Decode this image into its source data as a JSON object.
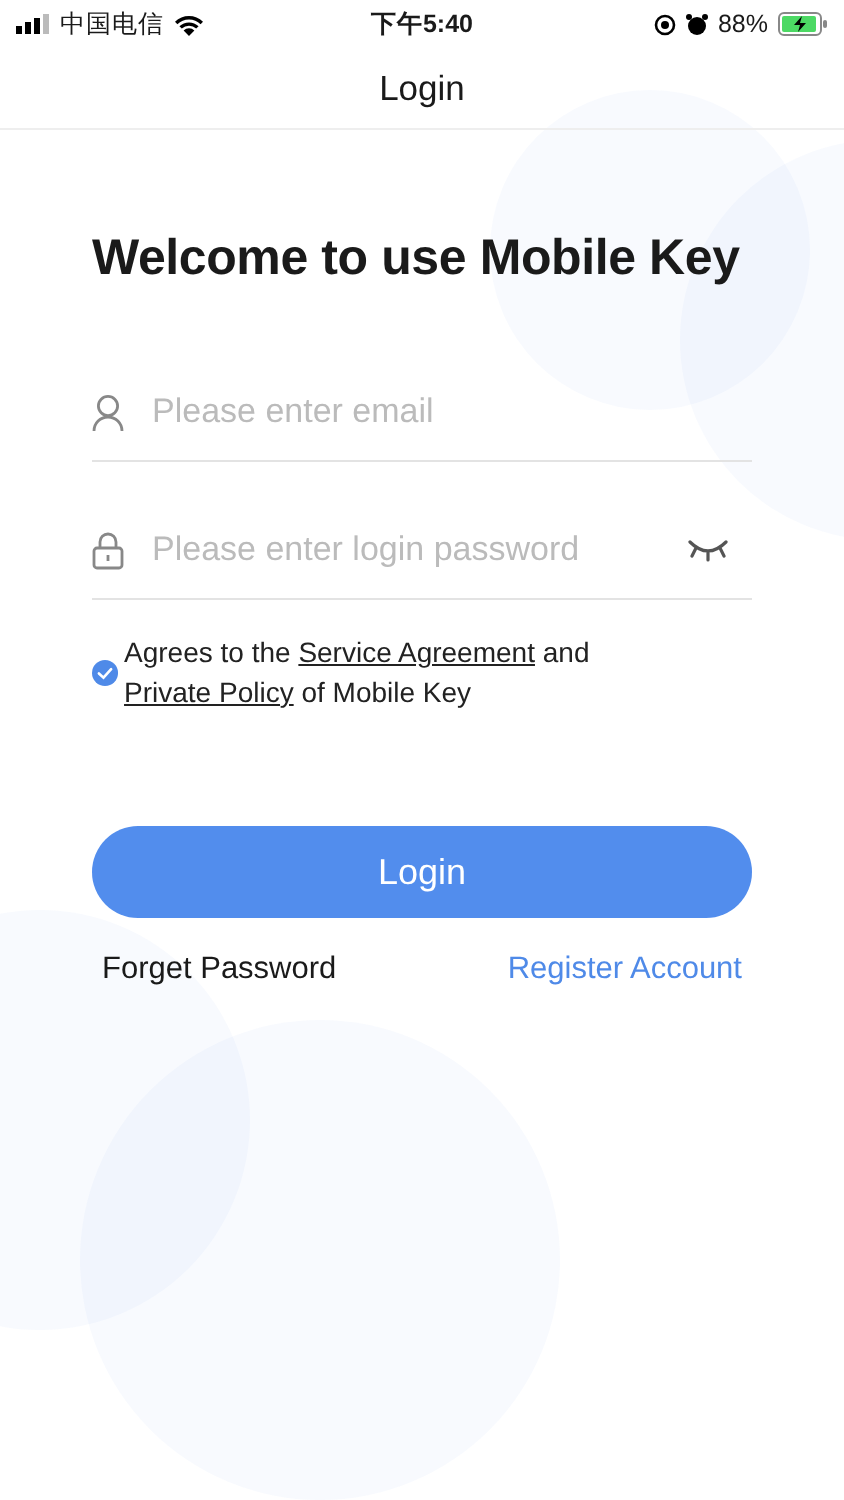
{
  "status_bar": {
    "carrier": "中国电信",
    "time": "下午5:40",
    "battery": "88%"
  },
  "nav": {
    "title": "Login"
  },
  "heading": "Welcome to use Mobile Key",
  "fields": [
    {
      "kind": "email",
      "placeholder": "Please enter email"
    },
    {
      "kind": "password",
      "placeholder": "Please enter login password"
    }
  ],
  "agreement": {
    "checked": true,
    "parts": [
      {
        "kind": "text",
        "text": "Agrees to the "
      },
      {
        "kind": "link",
        "text": "Service Agreement"
      },
      {
        "kind": "text",
        "text": " and "
      },
      {
        "kind": "link",
        "text": "Private Policy"
      },
      {
        "kind": "text",
        "text": " of Mobile Key"
      }
    ]
  },
  "login_button": "Login",
  "forget_link": "Forget Password",
  "register_link": "Register Account"
}
